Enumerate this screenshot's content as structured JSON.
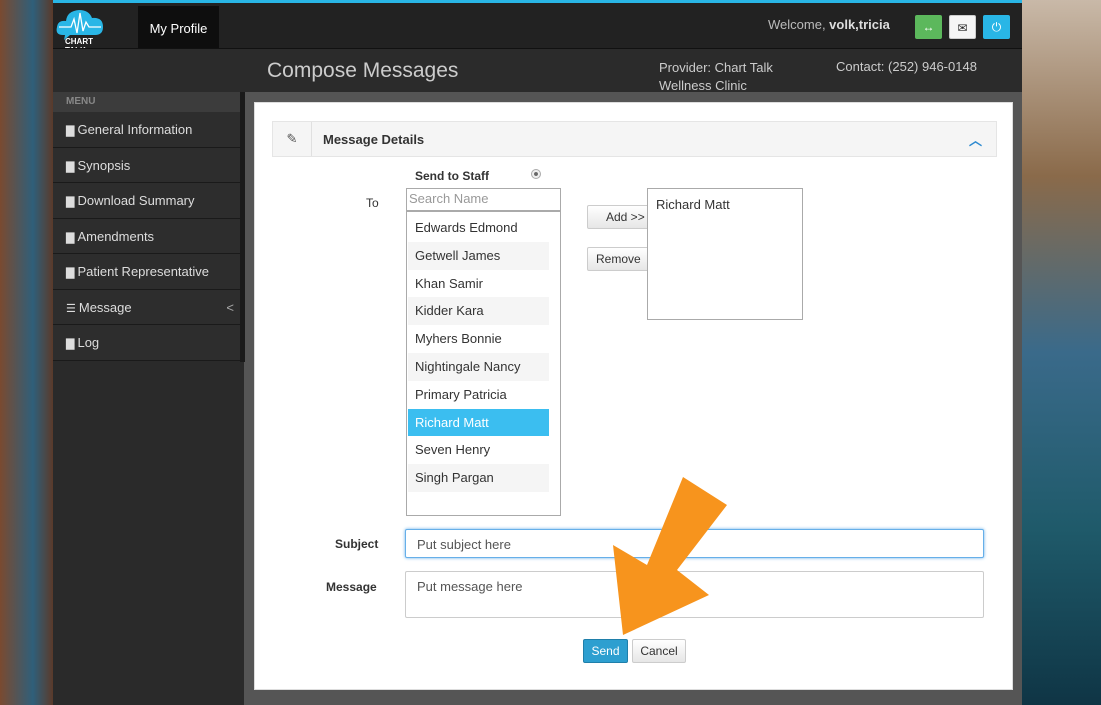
{
  "header": {
    "logo_text": "CHART TALK",
    "nav_item": "My Profile",
    "welcome_prefix": "Welcome, ",
    "username": "volk,tricia",
    "buttons": [
      {
        "icon": "arrows-h-icon",
        "color": "#5cb85c"
      },
      {
        "icon": "envelope-icon",
        "color": "#f5f5f5"
      },
      {
        "icon": "power-icon",
        "color": "#29b6e6"
      }
    ]
  },
  "subheader": {
    "title": "Compose Messages",
    "provider": "Provider: Chart Talk Wellness Clinic",
    "contact": "Contact: (252) 946-0148"
  },
  "sidebar": {
    "heading": "MENU",
    "items": [
      {
        "label": "General Information",
        "icon": "file-icon"
      },
      {
        "label": "Synopsis",
        "icon": "file-icon"
      },
      {
        "label": "Download Summary",
        "icon": "file-icon"
      },
      {
        "label": "Amendments",
        "icon": "file-icon"
      },
      {
        "label": "Patient Representative",
        "icon": "file-icon"
      },
      {
        "label": "Message",
        "icon": "list-icon",
        "chevron": "<"
      },
      {
        "label": "Log",
        "icon": "file-icon"
      }
    ]
  },
  "panel": {
    "title": "Message Details",
    "send_to_staff": "Send to Staff",
    "to_label": "To",
    "search_placeholder": "Search Name",
    "staff": [
      "Edwards Edmond",
      "Getwell James",
      "Khan Samir",
      "Kidder Kara",
      "Myhers Bonnie",
      "Nightingale Nancy",
      "Primary Patricia",
      "Richard Matt",
      "Seven Henry",
      "Singh Pargan"
    ],
    "selected_staff": "Richard Matt",
    "add_button": "Add >>",
    "remove_button": "Remove <<",
    "recipients": [
      "Richard Matt"
    ],
    "subject_label": "Subject",
    "subject_placeholder": "Put subject here",
    "message_label": "Message",
    "message_placeholder": "Put message here",
    "send_button": "Send",
    "cancel_button": "Cancel"
  },
  "colors": {
    "accent": "#29b6e6",
    "selected": "#3bbef0",
    "send": "#2d9fd0",
    "annotation_arrow": "#f7941d"
  }
}
